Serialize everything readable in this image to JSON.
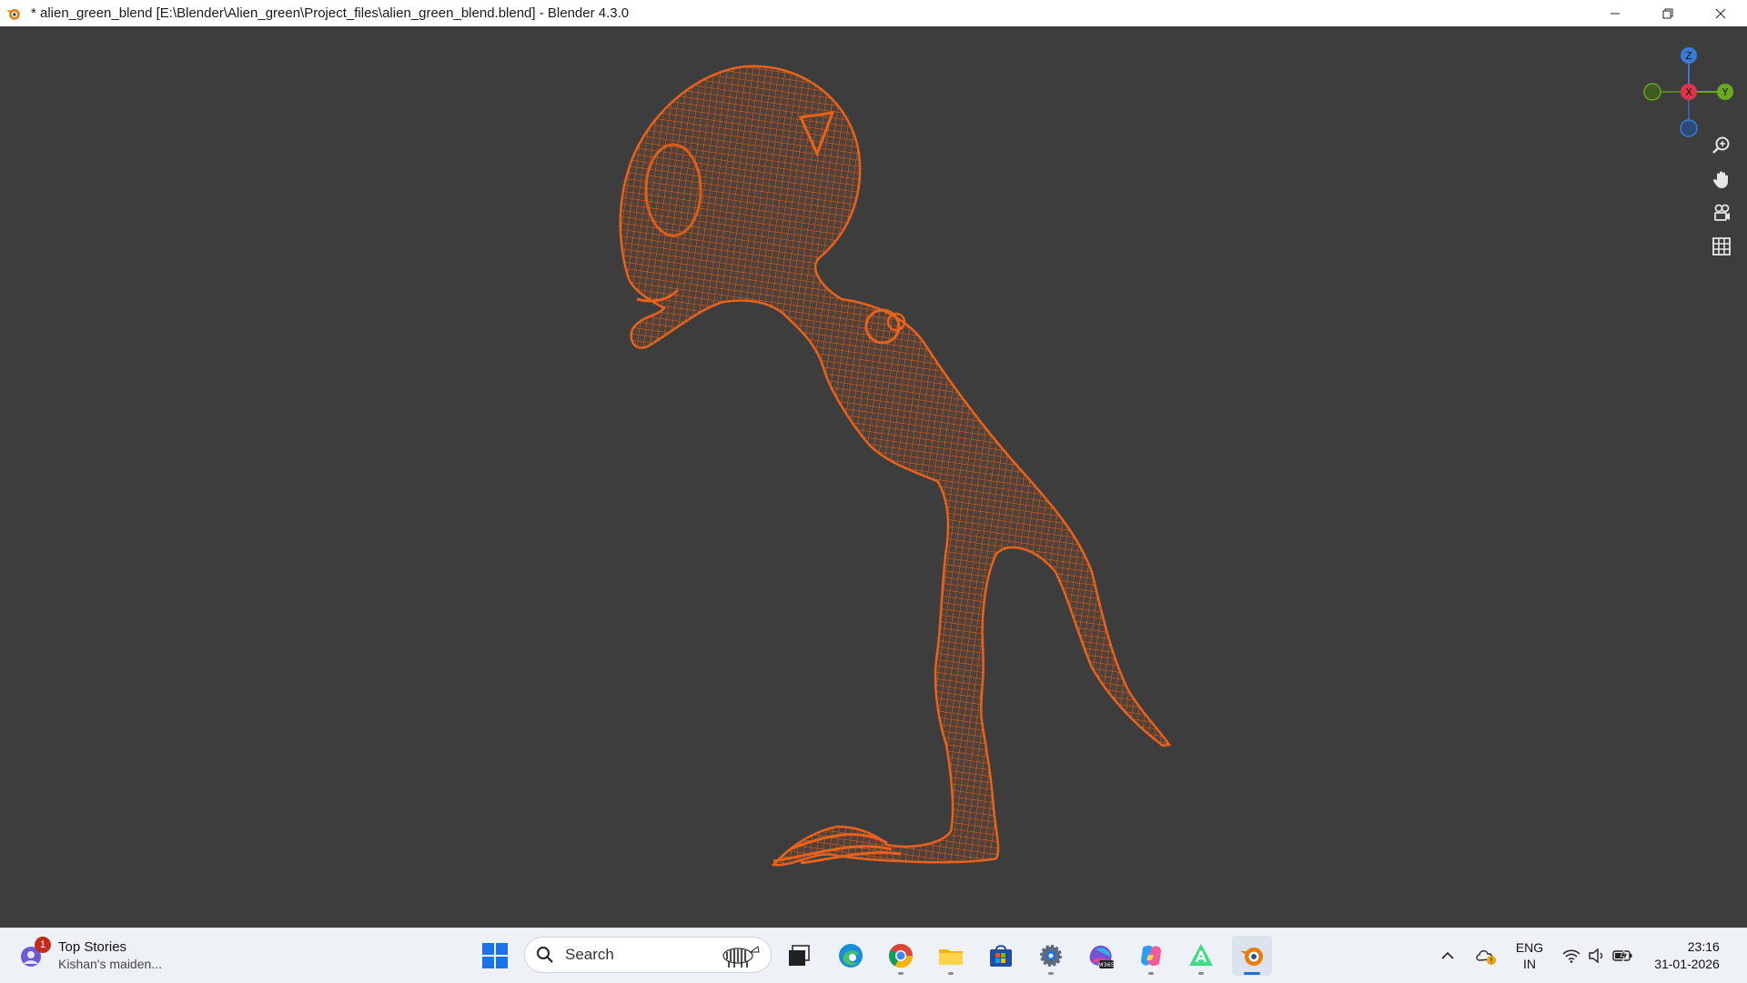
{
  "window": {
    "title": "* alien_green_blend [E:\\Blender\\Alien_green\\Project_files\\alien_green_blend.blend] - Blender 4.3.0",
    "app_icon": "blender-icon",
    "controls": [
      "minimize-icon",
      "restore-icon",
      "close-icon"
    ]
  },
  "viewport": {
    "object": "alien wireframe mesh",
    "wire_color": "#e8621c",
    "background": "#3d3d3d",
    "gizmo": {
      "z_label": "Z",
      "x_label": "X",
      "y_label": "Y",
      "z_color": "#3a7bd5",
      "x_color": "#e0334d",
      "y_color": "#6aa81d"
    },
    "nav_buttons": [
      "zoom-icon",
      "pan-hand-icon",
      "camera-view-icon",
      "perspective-grid-icon"
    ]
  },
  "taskbar": {
    "news": {
      "badge": "1",
      "title": "Top Stories",
      "subtitle": "Kishan's maiden..."
    },
    "search": {
      "placeholder": "Search"
    },
    "apps": [
      "windows-start-icon",
      "task-view-icon",
      "edge-icon",
      "chrome-icon",
      "file-explorer-icon",
      "ms-store-icon",
      "settings-icon",
      "m365-icon",
      "copilot-icon",
      "android-studio-icon",
      "blender-icon"
    ],
    "m365_label": "M365",
    "tray": {
      "lang_top": "ENG",
      "lang_bottom": "IN",
      "time": "23:16",
      "date": "31-01-2026"
    }
  }
}
